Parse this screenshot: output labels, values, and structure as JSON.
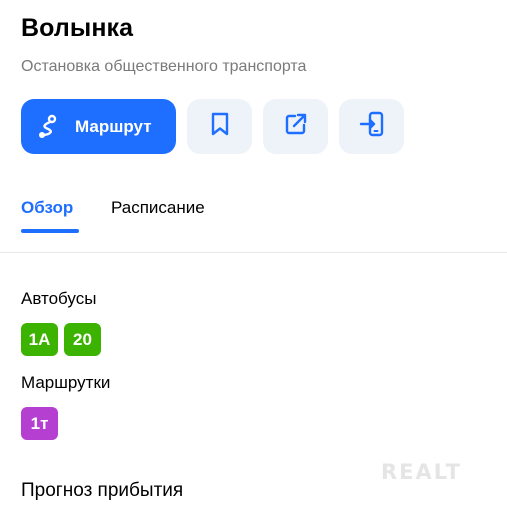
{
  "stop": {
    "name": "Волынка",
    "type": "Остановка общественного транспорта"
  },
  "actions": {
    "route_label": "Маршрут",
    "icons": [
      "route-icon",
      "bookmark-icon",
      "share-icon",
      "send-to-phone-icon"
    ]
  },
  "tabs": [
    {
      "label": "Обзор",
      "active": true
    },
    {
      "label": "Расписание",
      "active": false
    }
  ],
  "transport": {
    "buses": {
      "label": "Автобусы",
      "color": "#3cb300",
      "routes": [
        "1A",
        "20"
      ]
    },
    "minibuses": {
      "label": "Маршрутки",
      "color": "#b43fd0",
      "routes": [
        "1т"
      ]
    }
  },
  "forecast_label": "Прогноз прибытия",
  "watermark": "REALT"
}
